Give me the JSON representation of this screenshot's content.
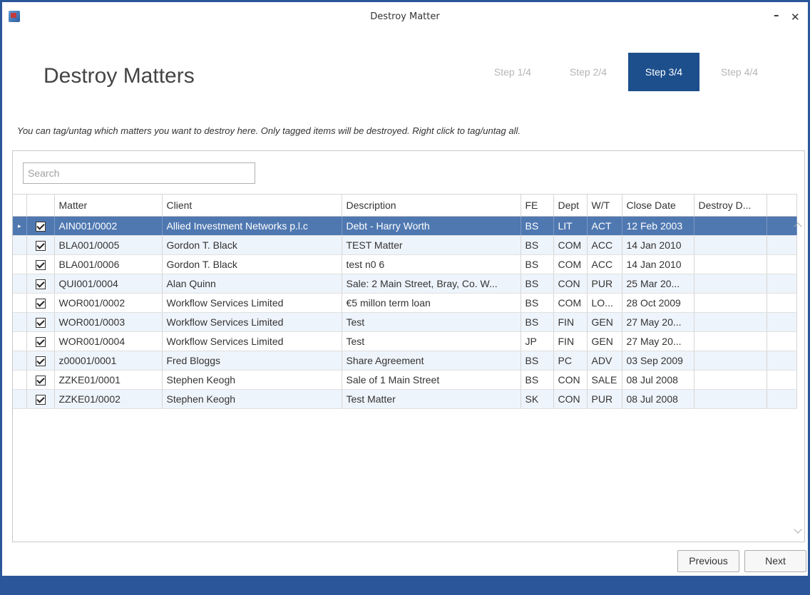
{
  "window": {
    "title": "Destroy Matter",
    "minimize_label": "–",
    "close_label": "✕"
  },
  "page": {
    "title": "Destroy Matters",
    "instructions": "You can tag/untag which matters you want to destroy here. Only tagged items will be destroyed. Right click to tag/untag all."
  },
  "steps": [
    {
      "label": "Step 1/4",
      "active": false
    },
    {
      "label": "Step 2/4",
      "active": false
    },
    {
      "label": "Step 3/4",
      "active": true
    },
    {
      "label": "Step 4/4",
      "active": false
    }
  ],
  "search": {
    "placeholder": "Search",
    "value": ""
  },
  "grid": {
    "columns": [
      "Matter",
      "Client",
      "Description",
      "FE",
      "Dept",
      "W/T",
      "Close Date",
      "Destroy D..."
    ],
    "rows": [
      {
        "checked": true,
        "cells": [
          "AIN001/0002",
          "Allied Investment Networks p.l.c",
          "Debt - Harry Worth",
          "BS",
          "LIT",
          "ACT",
          "12 Feb 2003",
          ""
        ]
      },
      {
        "checked": true,
        "cells": [
          "BLA001/0005",
          "Gordon T. Black",
          "TEST Matter",
          "BS",
          "COM",
          "ACC",
          "14 Jan 2010",
          ""
        ]
      },
      {
        "checked": true,
        "cells": [
          "BLA001/0006",
          "Gordon T. Black",
          "test n0 6",
          "BS",
          "COM",
          "ACC",
          "14 Jan 2010",
          ""
        ]
      },
      {
        "checked": true,
        "cells": [
          "QUI001/0004",
          "Alan Quinn",
          "Sale: 2 Main Street, Bray, Co. W...",
          "BS",
          "CON",
          "PUR",
          "25 Mar 20...",
          ""
        ]
      },
      {
        "checked": true,
        "cells": [
          "WOR001/0002",
          "Workflow Services Limited",
          "€5 millon term loan",
          "BS",
          "COM",
          "LO...",
          "28 Oct 2009",
          ""
        ]
      },
      {
        "checked": true,
        "cells": [
          "WOR001/0003",
          "Workflow Services Limited",
          "Test",
          "BS",
          "FIN",
          "GEN",
          "27 May 20...",
          ""
        ]
      },
      {
        "checked": true,
        "cells": [
          "WOR001/0004",
          "Workflow Services Limited",
          "Test",
          "JP",
          "FIN",
          "GEN",
          "27 May 20...",
          ""
        ]
      },
      {
        "checked": true,
        "cells": [
          "z00001/0001",
          "Fred Bloggs",
          "Share Agreement",
          "BS",
          "PC",
          "ADV",
          "03 Sep 2009",
          ""
        ]
      },
      {
        "checked": true,
        "cells": [
          "ZZKE01/0001",
          "Stephen Keogh",
          "Sale of 1 Main Street",
          "BS",
          "CON",
          "SALE",
          "08 Jul 2008",
          ""
        ]
      },
      {
        "checked": true,
        "cells": [
          "ZZKE01/0002",
          "Stephen Keogh",
          "Test Matter",
          "SK",
          "CON",
          "PUR",
          "08 Jul 2008",
          ""
        ]
      }
    ],
    "selected_row_index": 0,
    "row_indicator": "▸"
  },
  "buttons": {
    "previous": "Previous",
    "next": "Next"
  },
  "colors": {
    "accent": "#2b579a",
    "active_step": "#1c4f8c",
    "selected_row": "#4f78b1",
    "alt_row": "#eef4fb"
  }
}
